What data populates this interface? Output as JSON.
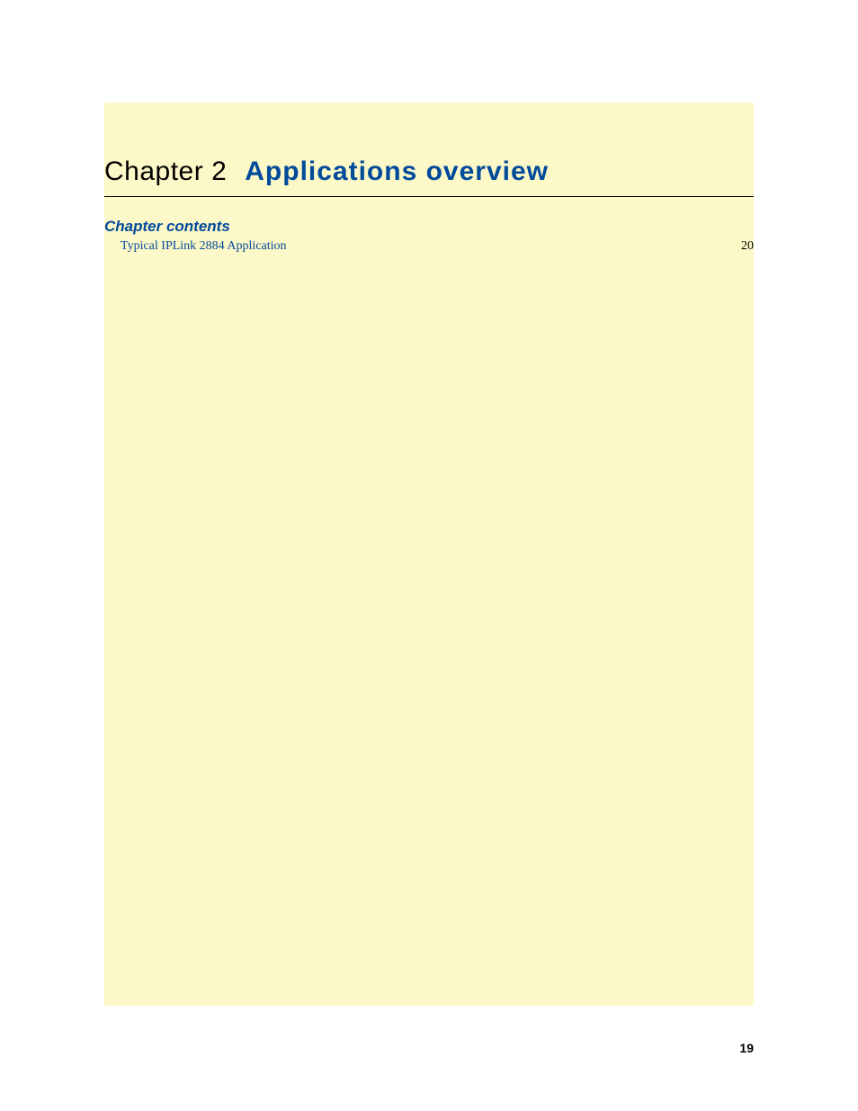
{
  "chapter": {
    "label": "Chapter 2",
    "title": "Applications overview"
  },
  "contents_heading": "Chapter contents",
  "toc": [
    {
      "title": "Typical IPLink 2884 Application",
      "page": "20"
    }
  ],
  "page_number": "19"
}
